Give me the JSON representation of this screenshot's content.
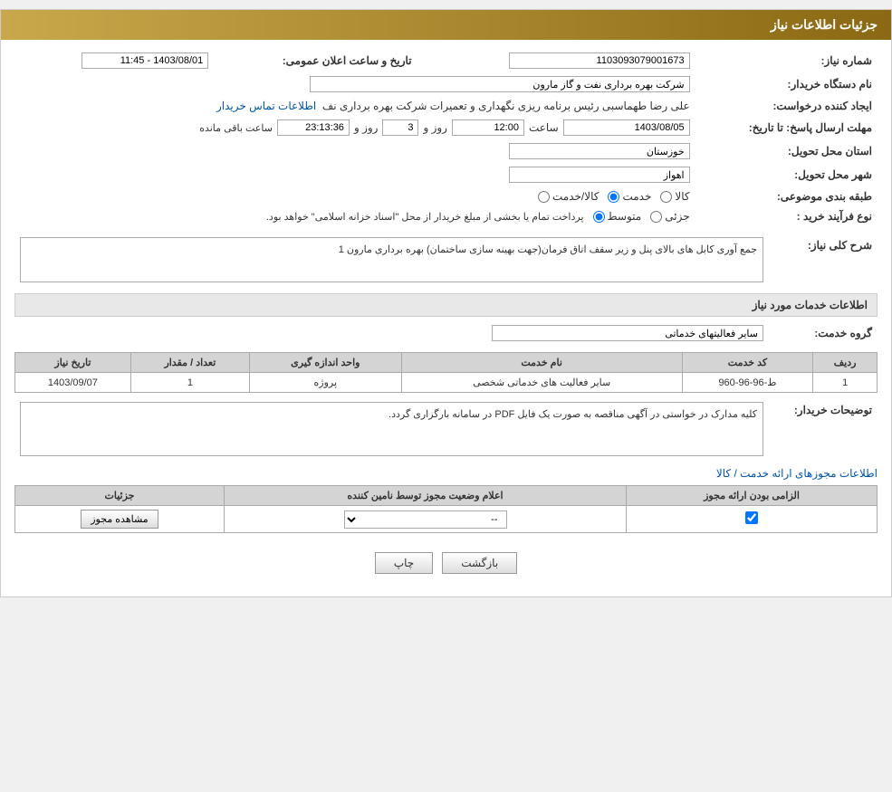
{
  "header": {
    "title": "جزئیات اطلاعات نیاز"
  },
  "fields": {
    "need_number_label": "شماره نیاز:",
    "need_number_value": "1103093079001673",
    "buyer_org_label": "نام دستگاه خریدار:",
    "buyer_org_value": "شرکت بهره برداری نفت و گاز مارون",
    "creator_label": "ایجاد کننده درخواست:",
    "creator_value": "علی رضا طهماسبی رئیس برنامه ریزی نگهداری و تعمیرات شرکت بهره برداری نف",
    "creator_link": "اطلاعات تماس خریدار",
    "announce_datetime_label": "تاریخ و ساعت اعلان عمومی:",
    "announce_datetime_value": "1403/08/01 - 11:45",
    "send_deadline_label": "مهلت ارسال پاسخ: تا تاریخ:",
    "send_date": "1403/08/05",
    "send_time": "12:00",
    "send_days": "3",
    "send_counter": "23:13:36",
    "send_remaining_label": "روز و",
    "send_time_label": "ساعت",
    "send_remaining2": "ساعت باقی مانده",
    "province_label": "استان محل تحویل:",
    "province_value": "خوزستان",
    "city_label": "شهر محل تحویل:",
    "city_value": "اهواز",
    "category_label": "طبقه بندی موضوعی:",
    "category_options": [
      "کالا",
      "خدمت",
      "کالا/خدمت"
    ],
    "category_selected": "خدمت",
    "purchase_type_label": "نوع فرآیند خرید :",
    "purchase_options": [
      "جزئی",
      "متوسط"
    ],
    "purchase_note": "پرداخت تمام یا بخشی از مبلغ خریدار از محل \"اسناد خزانه اسلامی\" خواهد بود.",
    "description_label": "شرح کلی نیاز:",
    "description_value": "جمع آوری کابل های بالای پنل و زیر سقف اتاق فرمان(جهت بهینه سازی ساختمان) بهره برداری مارون 1"
  },
  "services_section": {
    "title": "اطلاعات خدمات مورد نیاز",
    "service_group_label": "گروه خدمت:",
    "service_group_value": "سایر فعالیتهای خدماتی",
    "table": {
      "columns": [
        "ردیف",
        "کد خدمت",
        "نام خدمت",
        "واحد اندازه گیری",
        "تعداد / مقدار",
        "تاریخ نیاز"
      ],
      "rows": [
        {
          "row_num": "1",
          "service_code": "ط-96-96-960",
          "service_name": "سایر فعالیت های خدماتی شخصی",
          "unit": "پروژه",
          "quantity": "1",
          "date": "1403/09/07"
        }
      ]
    }
  },
  "buyer_notes_label": "توضیحات خریدار:",
  "buyer_notes_value": "کلیه مدارک در خواستی در آگهی مناقصه به صورت یک فایل PDF  در سامانه بارگزاری گردد.",
  "permits_section": {
    "title": "اطلاعات مجوزهای ارائه خدمت / کالا",
    "table": {
      "columns": [
        "الزامی بودن ارائه مجوز",
        "اعلام وضعیت مجوز توسط نامین کننده",
        "جزئیات"
      ],
      "rows": [
        {
          "required": true,
          "status_value": "--",
          "details_label": "مشاهده مجوز"
        }
      ]
    }
  },
  "buttons": {
    "print_label": "چاپ",
    "back_label": "بازگشت"
  }
}
